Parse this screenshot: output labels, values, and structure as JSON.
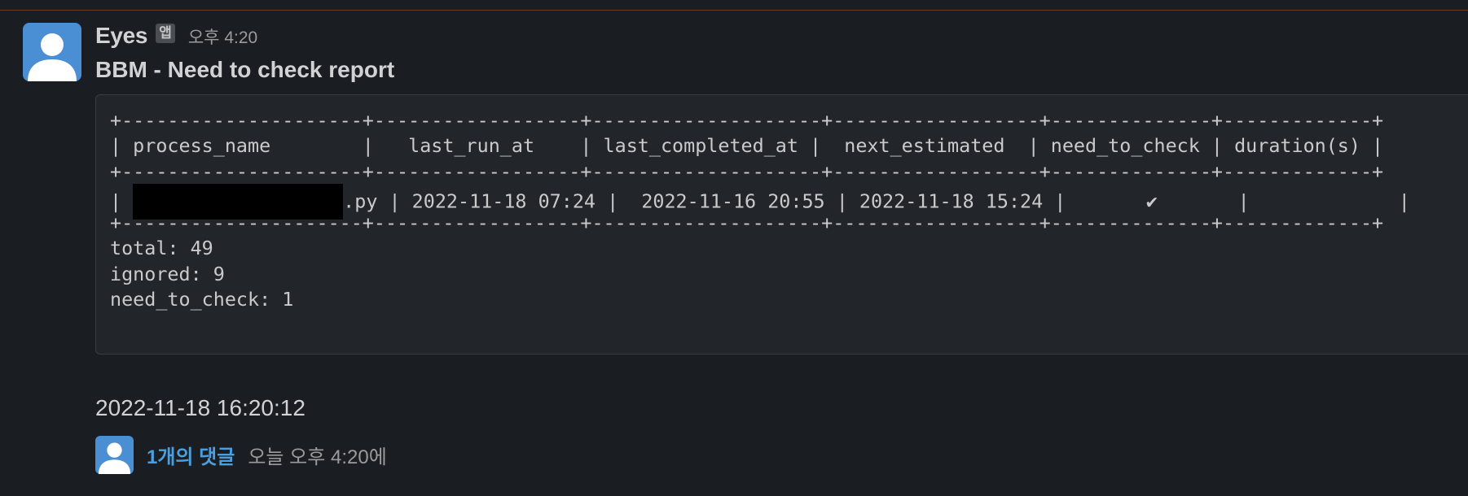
{
  "message": {
    "sender": "Eyes",
    "app_badge": "앱",
    "time": "오후 4:20",
    "title": "BBM - Need to check report",
    "icons": {
      "avatar": "user-silhouette",
      "reply_avatar": "user-silhouette"
    },
    "colors": {
      "background": "#1a1d21",
      "avatar": "#4a8fd4",
      "link": "#4b9fde"
    }
  },
  "report": {
    "border_top": "+---------------------+------------------+--------------------+------------------+--------------+-------------+",
    "header_row": "| process_name        |   last_run_at    | last_completed_at |  next_estimated  | need_to_check | duration(s) |",
    "border_mid": "+---------------------+------------------+--------------------+------------------+--------------+-------------+",
    "data_row_prefix": "| ",
    "data_row_suffix": ".py | 2022-11-18 07:24 |  2022-11-16 20:55 | 2022-11-18 15:24 |       ✔       |             |",
    "border_bottom": "+---------------------+------------------+--------------------+------------------+--------------+-------------+",
    "total": "total: 49",
    "ignored": "ignored: 9",
    "need_to_check": "need_to_check: 1"
  },
  "timestamp": "2022-11-18 16:20:12",
  "thread": {
    "reply_count": "1개의 댓글",
    "reply_time": "오늘 오후 4:20에"
  }
}
